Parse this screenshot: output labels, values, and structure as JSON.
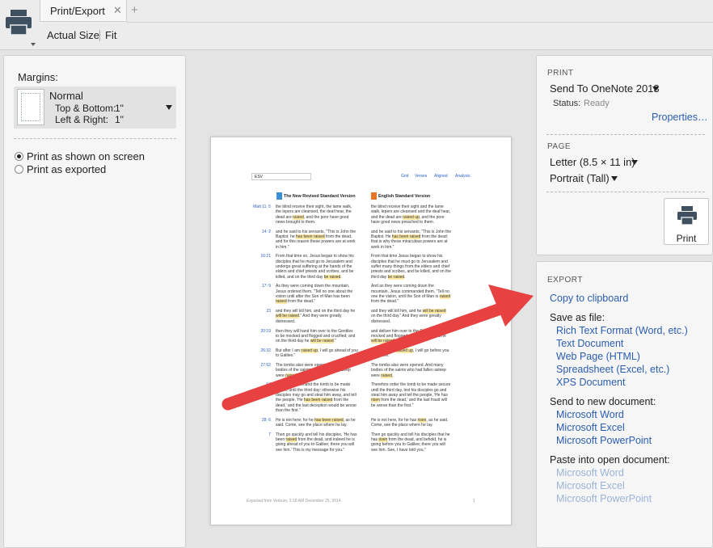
{
  "toolbar": {
    "tab_title": "Print/Export",
    "tab_close": "✕",
    "tab_add": "+",
    "actual_size": "Actual Size",
    "fit": "Fit"
  },
  "left": {
    "margins_label": "Margins:",
    "margin_name": "Normal",
    "top_bottom_label": "Top & Bottom:",
    "top_bottom_value": "1\"",
    "left_right_label": "Left & Right:",
    "left_right_value": "1\"",
    "option_screen": "Print as shown on screen",
    "option_exported": "Print as exported"
  },
  "preview": {
    "version": "ESV",
    "links": [
      "Grid",
      "Verses",
      "Aligned",
      "Analysis"
    ],
    "heading_left": "The New Revised Standard Version",
    "heading_right": "English Standard Version",
    "footer_left": "Exported from Verbum, 2:18 AM December 25, 2014.",
    "footer_right": "1",
    "rows": [
      {
        "ref": "Matt 11: 5",
        "left": [
          "the blind receive their sight, the lame walk,",
          "the lepers are cleansed, the deaf hear, the",
          "dead are raised, and the poor have good",
          "news brought to them."
        ],
        "right": [
          "the blind receive their sight and the lame",
          "walk, lepers are cleansed and the deaf hear,",
          "and the dead are raised up, and the poor",
          "have good news preached to them."
        ]
      },
      {
        "ref": "14: 2",
        "left": [
          "and he said to his servants, \"This is John the",
          "Baptist; he has been raised from the dead,",
          "and for this reason these powers are at work",
          "in him.\""
        ],
        "right": [
          "and he said to his servants, \"This is John the",
          "Baptist. He has been raised from the dead;",
          "that is why these miraculous powers are at",
          "work in him.\""
        ]
      },
      {
        "ref": "16:21",
        "left": [
          "From that time on, Jesus began to show his",
          "disciples that he must go to Jerusalem and",
          "undergo great suffering at the hands of the",
          "elders and chief priests and scribes, and be",
          "killed, and on the third day be raised."
        ],
        "right": [
          "From that time Jesus began to show his",
          "disciples that he must go to Jerusalem and",
          "suffer many things from the elders and chief",
          "priests and scribes, and be killed, and on the",
          "third day be raised."
        ]
      },
      {
        "ref": "17: 9",
        "left": [
          "As they were coming down the mountain,",
          "Jesus ordered them, \"Tell no one about the",
          "vision until after the Son of Man has been",
          "raised from the dead.\""
        ],
        "right": [
          "And as they were coming down the",
          "mountain, Jesus commanded them, \"Tell no",
          "one the vision, until the Son of Man is raised",
          "from the dead.\""
        ]
      },
      {
        "ref": "23",
        "left": [
          "and they will kill him, and on the third day he",
          "will be raised.\" And they were greatly",
          "distressed."
        ],
        "right": [
          "and they will kill him, and he will be raised",
          "on the third day.\" And they were greatly",
          "distressed."
        ]
      },
      {
        "ref": "20:19",
        "left": [
          "then they will hand him over to the Gentiles",
          "to be mocked and flogged and crucified; and",
          "on the third day he will be raised.\""
        ],
        "right": [
          "and deliver him over to the Gentiles to be",
          "mocked and flogged and crucified, and he",
          "will be raised on the third day.\""
        ]
      },
      {
        "ref": "26:32",
        "left": [
          "But after I am raised up, I will go ahead of you",
          "to Galilee.\""
        ],
        "right": [
          "But after I am raised up, I will go before you",
          "to Galilee.\""
        ]
      },
      {
        "ref": "27:52",
        "left": [
          "The tombs also were opened, and many",
          "bodies of the saints who had fallen asleep",
          "were raised."
        ],
        "right": [
          "The tombs also were opened. And many",
          "bodies of the saints who had fallen asleep",
          "were raised,"
        ]
      },
      {
        "ref": "64",
        "left": [
          "Therefore command the tomb to be made",
          "secure until the third day; otherwise his",
          "disciples may go and steal him away, and tell",
          "the people, 'He has been raised from the",
          "dead,' and the last deception would be worse",
          "than the first.\""
        ],
        "right": [
          "Therefore order the tomb to be made secure",
          "until the third day, lest his disciples go and",
          "steal him away and tell the people, 'He has",
          "risen from the dead,' and the last fraud will",
          "be worse than the first.\""
        ]
      },
      {
        "ref": "28: 6",
        "left": [
          "He is not here; for he has been raised, as he",
          "said. Come, see the place where he lay."
        ],
        "right": [
          "He is not here, for he has risen, as he said.",
          "Come, see the place where he lay."
        ]
      },
      {
        "ref": "7",
        "left": [
          "Then go quickly and tell his disciples, 'He has",
          "been raised from the dead, and indeed he is",
          "going ahead of you to Galilee; there you will",
          "see him.' This is my message for you.\""
        ],
        "right": [
          "Then go quickly and tell his disciples that he",
          "has risen from the dead, and behold, he is",
          "going before you to Galilee; there you will",
          "see him. See, I have told you.\""
        ]
      }
    ]
  },
  "print": {
    "section_title": "PRINT",
    "printer": "Send To OneNote 2013",
    "status_label": "Status:",
    "status_value": "Ready",
    "properties": "Properties…",
    "page_title": "PAGE",
    "paper": "Letter (8.5 × 11 in)",
    "orientation": "Portrait (Tall)",
    "print_button": "Print"
  },
  "export": {
    "section_title": "EXPORT",
    "clipboard": "Copy to clipboard",
    "save_as_label": "Save as file:",
    "save_as": [
      "Rich Text Format (Word, etc.)",
      "Text Document",
      "Web Page (HTML)",
      "Spreadsheet (Excel, etc.)",
      "XPS Document"
    ],
    "send_label": "Send to new document:",
    "send": [
      "Microsoft Word",
      "Microsoft Excel",
      "Microsoft PowerPoint"
    ],
    "paste_label": "Paste into open document:",
    "paste": [
      "Microsoft Word",
      "Microsoft Excel",
      "Microsoft PowerPoint"
    ]
  },
  "colors": {
    "link": "#2a5db0",
    "disabled_link": "#9bb3d6",
    "highlight": "#fce9a6",
    "arrow": "#e84141"
  }
}
